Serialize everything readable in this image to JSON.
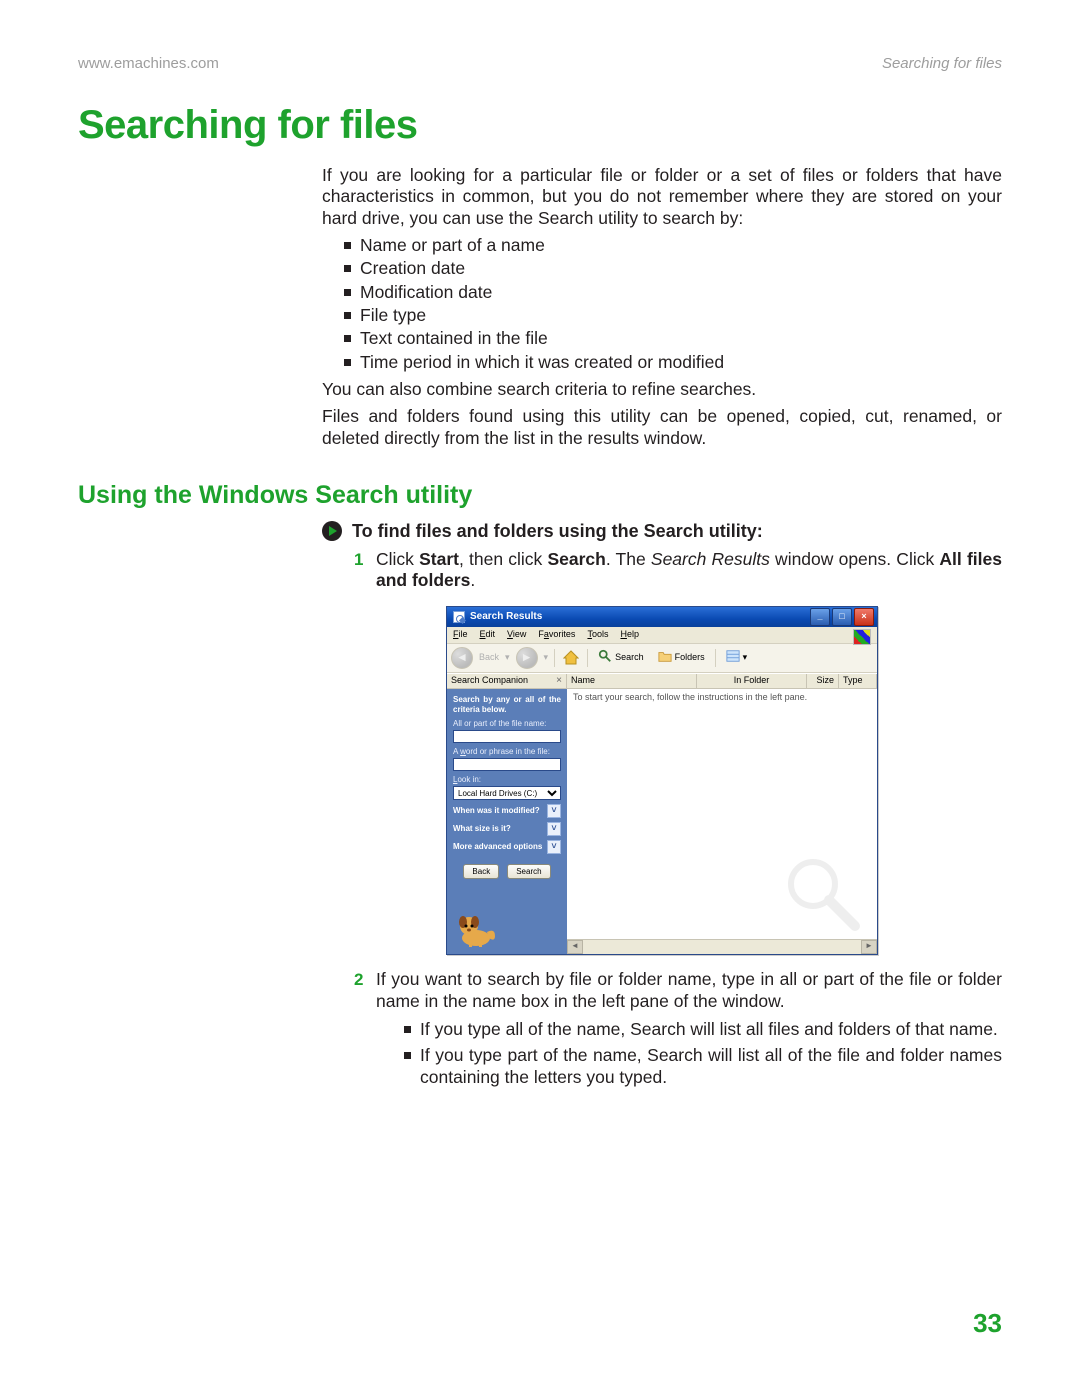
{
  "header": {
    "left": "www.emachines.com",
    "right": "Searching for files"
  },
  "h1": "Searching for files",
  "intro": "If you are looking for a particular file or folder or a set of files or folders that have characteristics in common, but you do not remember where they are stored on your hard drive, you can use the Search utility to search by:",
  "criteria_list": [
    "Name or part of a name",
    "Creation date",
    "Modification date",
    "File type",
    "Text contained in the file",
    "Time period in which it was created or modified"
  ],
  "para_combine": "You can also combine search criteria to refine searches.",
  "para_results": "Files and folders found using this utility can be opened, copied, cut, renamed, or deleted directly from the list in the results window.",
  "h2": "Using the Windows Search utility",
  "proc_title": "To find files and folders using the Search utility:",
  "step1": {
    "pre": "Click ",
    "start": "Start",
    "mid1": ", then click ",
    "search": "Search",
    "mid2": ". The ",
    "sr": "Search Results",
    "mid3": " window opens. Click ",
    "all": "All files and folders",
    "end": "."
  },
  "step2": {
    "text": "If you want to search by file or folder name, type in all or part of the file or folder name in the name box in the left pane of the window.",
    "sub": [
      "If you type all of the name, Search will list all files and folders of that name.",
      "If you type part of the name, Search will list all of the file and folder names containing the letters you typed."
    ]
  },
  "figure": {
    "title": "Search Results",
    "menu": {
      "file": "File",
      "edit": "Edit",
      "view": "View",
      "favorites": "Favorites",
      "tools": "Tools",
      "help": "Help"
    },
    "toolbar": {
      "back": "Back",
      "search": "Search",
      "folders": "Folders"
    },
    "columns": {
      "sc": "Search Companion",
      "name": "Name",
      "folder": "In Folder",
      "size": "Size",
      "type": "Type"
    },
    "tip": "To start your search, follow the instructions in the left pane.",
    "left": {
      "heading": "Search by any or all of the criteria below.",
      "lbl_name": "All or part of the file name:",
      "lbl_word": "A word or phrase in the file:",
      "lbl_lookin": "Look in:",
      "lookin_value": "Local Hard Drives (C:)",
      "exp1": "When was it modified?",
      "exp2": "What size is it?",
      "exp3": "More advanced options",
      "btn_back": "Back",
      "btn_search": "Search"
    }
  },
  "page_number": "33"
}
